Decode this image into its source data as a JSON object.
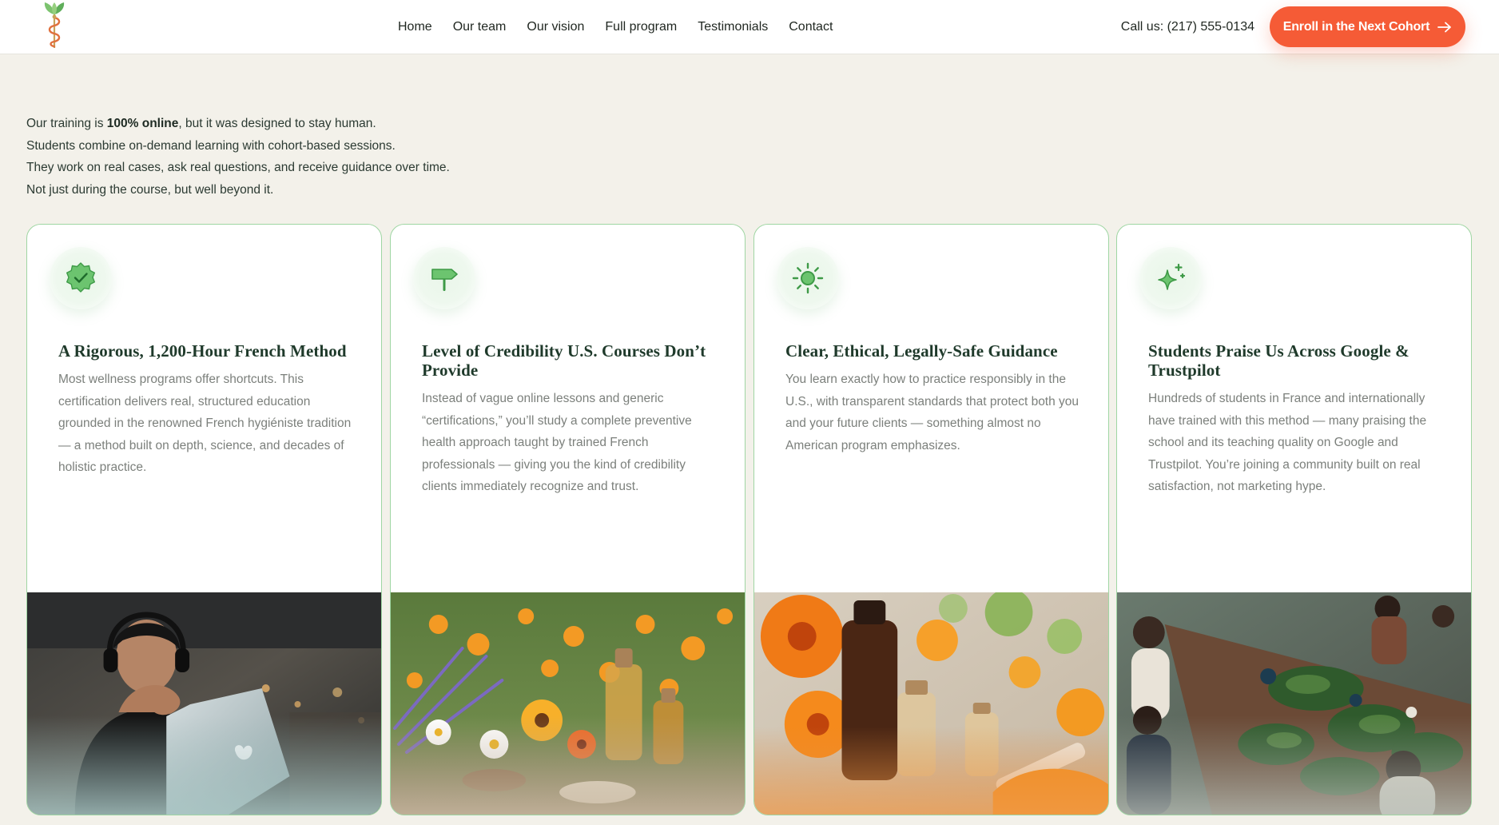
{
  "header": {
    "nav": [
      "Home",
      "Our team",
      "Our vision",
      "Full program",
      "Testimonials",
      "Contact"
    ],
    "phone": "Call us: (217) 555-0134",
    "cta_label": "Enroll in the Next Cohort",
    "cta_color": "#f55b36"
  },
  "intro": {
    "line1_pre": "Our training is ",
    "line1_strong": "100% online",
    "line1_post": ", but it was designed to stay human.",
    "line2": "Students combine on-demand learning with cohort-based sessions.",
    "line3": "They work on real cases, ask real questions, and receive guidance over time.",
    "line4": "Not just during the course, but well beyond it."
  },
  "cards": [
    {
      "icon": "verified-badge-icon",
      "title": "A Rigorous, 1,200-Hour French Method",
      "text": "Most wellness programs offer shortcuts. This certification delivers real, structured education grounded in the renowned French hygiéniste tradition — a method built on depth, science, and decades of holistic practice.",
      "image": "student-laptop-photo"
    },
    {
      "icon": "signpost-icon",
      "title": "Level of Credibility U.S. Courses Don’t Provide",
      "text": "Instead of vague online lessons and generic “certifications,” you’ll study a complete preventive health approach taught by trained French professionals — giving you the kind of credibility clients immediately recognize and trust.",
      "image": "herbal-flowers-bottles-photo"
    },
    {
      "icon": "sun-icon",
      "title": "Clear, Ethical, Legally-Safe Guidance",
      "text": "You learn exactly how to practice responsibly in the U.S., with transparent standards that protect both you and your future clients — something almost no American program emphasizes.",
      "image": "calendula-oil-photo"
    },
    {
      "icon": "sparkle-icon",
      "title": "Students Praise Us Across Google & Trustpilot",
      "text": "Hundreds of students in France and internationally have trained with this method — many praising the school and its teaching quality on Google and Trustpilot. You’re joining a community built on real satisfaction, not marketing hype.",
      "image": "students-workshop-photo"
    }
  ],
  "colors": {
    "background": "#f3f1ea",
    "accent_green": "#5dbb63",
    "card_border": "#9fd6a3",
    "title_green": "#1f3a2b",
    "body_gray": "#7c807c"
  }
}
